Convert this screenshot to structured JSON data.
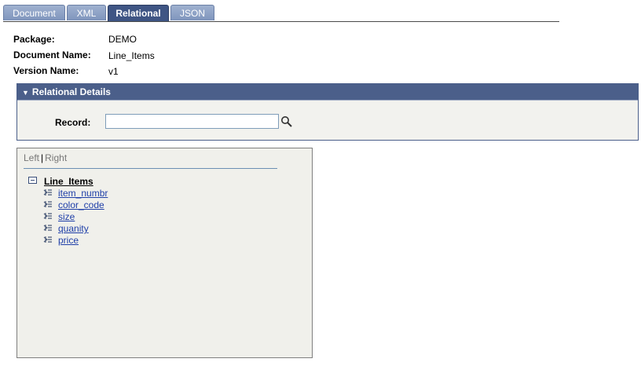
{
  "tabs": [
    {
      "label": "Document",
      "active": false
    },
    {
      "label": "XML",
      "active": false
    },
    {
      "label": "Relational",
      "active": true
    },
    {
      "label": "JSON",
      "active": false
    }
  ],
  "info": {
    "package_label": "Package:",
    "package_value": "DEMO",
    "document_label": "Document Name:",
    "document_value": "Line_Items",
    "version_label": "Version Name:",
    "version_value": "v1"
  },
  "relational_details": {
    "title": "Relational Details",
    "record_label": "Record:",
    "record_value": ""
  },
  "tree": {
    "left_label": "Left",
    "separator": "|",
    "right_label": "Right",
    "root": "Line_Items",
    "items": [
      "item_numbr",
      "color_code",
      "size",
      "quanity",
      "price"
    ]
  },
  "colors": {
    "header_blue": "#4b5f8a",
    "link_blue": "#1f3fa8",
    "tab_active": "#3f5584"
  }
}
